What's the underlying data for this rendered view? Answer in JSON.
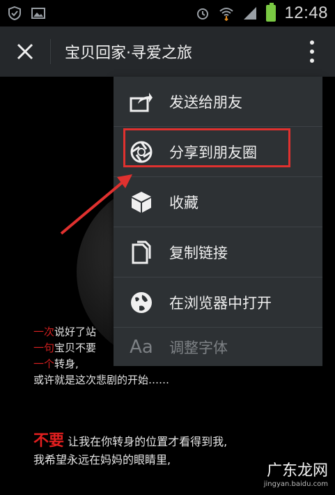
{
  "status_bar": {
    "time": "12:48",
    "icons_left": [
      "shield-icon",
      "image-icon"
    ],
    "icons_right": [
      "alarm-icon",
      "wifi-icon",
      "signal-icon",
      "battery-icon"
    ]
  },
  "header": {
    "title": "宝贝回家·寻爱之旅"
  },
  "menu": {
    "items": [
      {
        "label": "发送给朋友",
        "icon": "share-to-friend-icon"
      },
      {
        "label": "分享到朋友圈",
        "icon": "moments-icon"
      },
      {
        "label": "收藏",
        "icon": "favorite-cube-icon"
      },
      {
        "label": "复制链接",
        "icon": "copy-link-icon"
      },
      {
        "label": "在浏览器中打开",
        "icon": "globe-icon"
      },
      {
        "label": "调整字体",
        "icon": "font-size-icon"
      }
    ]
  },
  "poster": {
    "line1_red": "一次",
    "line1_text": "说好了站",
    "line2_red": "一句",
    "line2_text": "宝贝不要",
    "line3_red": "一个",
    "line3_text": "转身,",
    "line4": "或许就是这次悲剧的开始……",
    "big_red": "不要",
    "line5": "让我在你转身的位置才看得到我,",
    "line6": "我希望永远在妈妈的眼睛里,",
    "watermark": "广东龙网",
    "watermark_sub": "jingyan.baidu.com"
  },
  "colors": {
    "highlight": "#e0312f",
    "menu_bg": "#2d3134",
    "header_bg": "#25282b"
  }
}
